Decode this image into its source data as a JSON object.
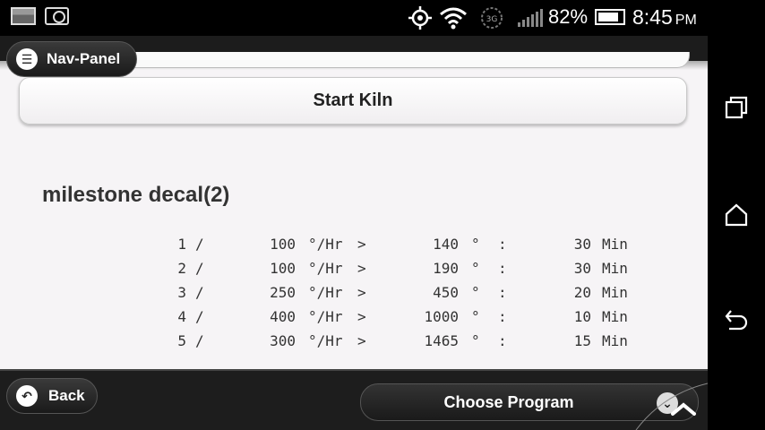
{
  "statusbar": {
    "battery_percent": "82%",
    "battery_level": 0.82,
    "time": "8:45",
    "ampm": "PM",
    "network_label": "3G"
  },
  "app": {
    "nav_panel_label": "Nav-Panel",
    "start_kiln_label": "Start Kiln",
    "program_title": "milestone decal(2)",
    "segments": [
      {
        "num": "1",
        "slash": "/",
        "rate": "100",
        "rate_unit": "°/Hr",
        "gt": ">",
        "temp": "140",
        "deg": "°",
        "colon": ":",
        "hold": "30",
        "hold_unit": "Min"
      },
      {
        "num": "2",
        "slash": "/",
        "rate": "100",
        "rate_unit": "°/Hr",
        "gt": ">",
        "temp": "190",
        "deg": "°",
        "colon": ":",
        "hold": "30",
        "hold_unit": "Min"
      },
      {
        "num": "3",
        "slash": "/",
        "rate": "250",
        "rate_unit": "°/Hr",
        "gt": ">",
        "temp": "450",
        "deg": "°",
        "colon": ":",
        "hold": "20",
        "hold_unit": "Min"
      },
      {
        "num": "4",
        "slash": "/",
        "rate": "400",
        "rate_unit": "°/Hr",
        "gt": ">",
        "temp": "1000",
        "deg": "°",
        "colon": ":",
        "hold": "10",
        "hold_unit": "Min"
      },
      {
        "num": "5",
        "slash": "/",
        "rate": "300",
        "rate_unit": "°/Hr",
        "gt": ">",
        "temp": "1465",
        "deg": "°",
        "colon": ":",
        "hold": "15",
        "hold_unit": "Min"
      }
    ],
    "back_label": "Back",
    "choose_program_label": "Choose Program"
  },
  "icons": {
    "gallery": "gallery-icon",
    "camera": "camera-icon",
    "gps": "gps-icon",
    "wifi": "wifi-icon",
    "signal": "signal-icon",
    "battery": "battery-icon",
    "menu": "menu-icon",
    "back": "back-arrow-icon",
    "chevron": "chevron-down-icon",
    "recent": "recent-apps-icon",
    "home": "home-icon",
    "nav_back": "nav-back-icon"
  }
}
